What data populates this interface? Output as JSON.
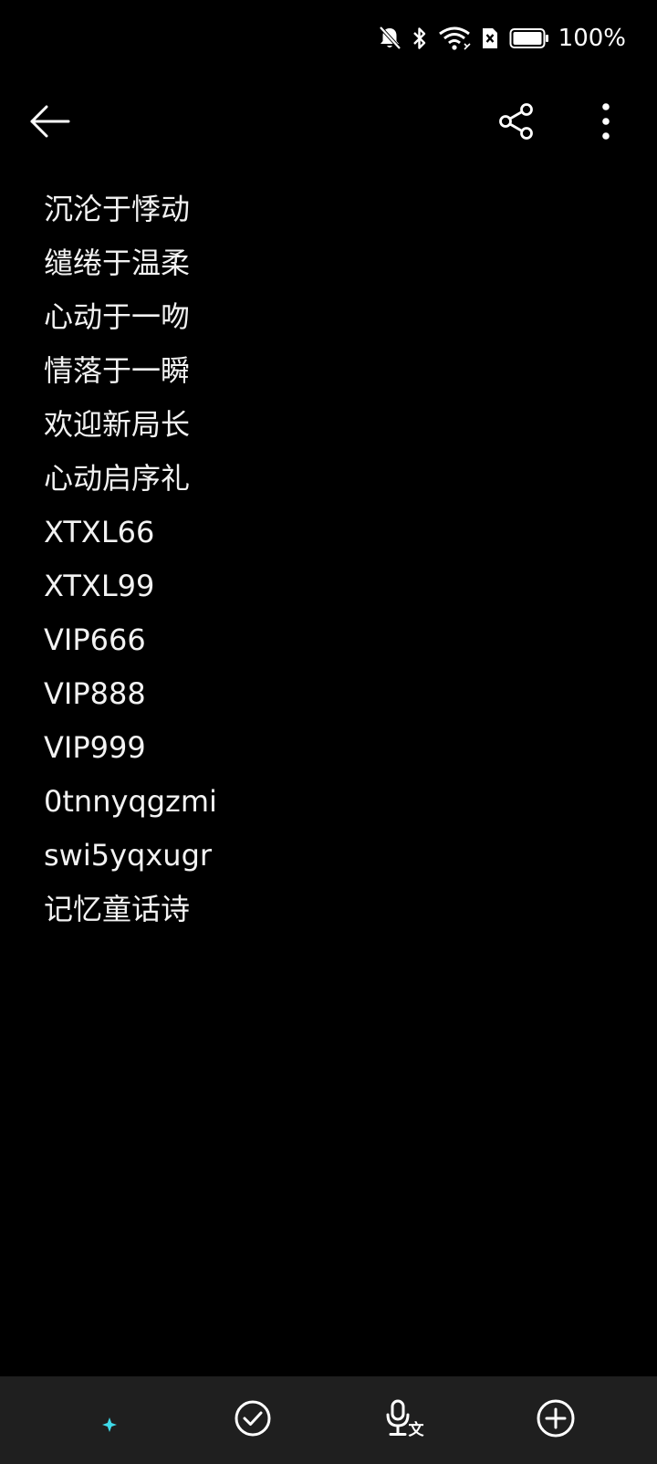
{
  "status_bar": {
    "battery_percent": "100%",
    "icons": [
      "bell-off-icon",
      "bluetooth-icon",
      "wifi-icon",
      "sim-off-icon",
      "battery-icon"
    ]
  },
  "toolbar": {
    "icons": [
      "back-arrow-icon",
      "share-icon",
      "more-vertical-icon"
    ]
  },
  "note": {
    "lines": [
      "沉沦于悸动",
      "缱绻于温柔",
      "心动于一吻",
      "情落于一瞬",
      "欢迎新局长",
      "心动启序礼",
      "XTXL66",
      "XTXL99",
      "VIP666",
      "VIP888",
      "VIP999",
      "0tnnyqgzmi",
      "swi5yqxugr",
      "记忆童话诗"
    ]
  },
  "bottom_bar": {
    "icons": [
      "ai-format-icon",
      "checklist-icon",
      "voice-to-text-icon",
      "add-icon"
    ]
  },
  "colors": {
    "background": "#000000",
    "text": "#f2f2f2",
    "bottom_bar": "#1f1f1f"
  }
}
